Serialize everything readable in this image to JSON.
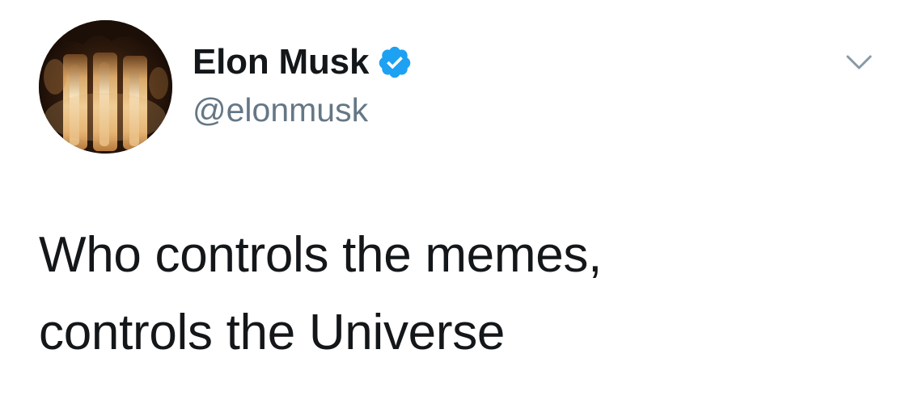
{
  "author": {
    "display_name": "Elon Musk",
    "handle": "@elonmusk",
    "verified": true,
    "avatar_icon": "avatar-rocket-engines-image"
  },
  "tweet": {
    "lines": [
      "Who controls the memes,",
      "controls the Universe"
    ]
  },
  "icons": {
    "verified": "verified-badge-icon",
    "menu": "chevron-down-icon"
  },
  "colors": {
    "name": "#14171a",
    "handle": "#657786",
    "verified_badge": "#1da1f2",
    "chevron": "#8899a6",
    "text": "#14171a",
    "background": "#ffffff"
  }
}
